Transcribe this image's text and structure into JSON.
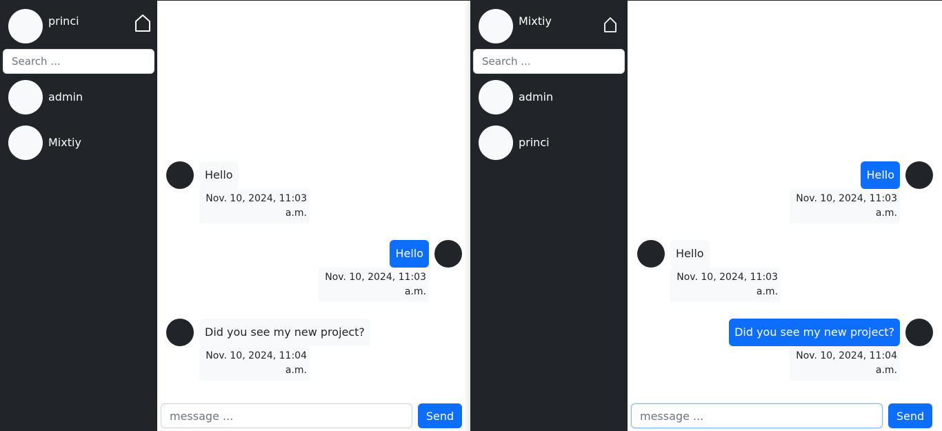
{
  "windows": [
    {
      "current_user": "princi",
      "search_placeholder": "Search ...",
      "contacts": [
        {
          "name": "admin"
        },
        {
          "name": "Mixtiy"
        }
      ],
      "messages": [
        {
          "direction": "in",
          "text": "Hello",
          "timestamp": "Nov. 10, 2024, 11:03 a.m."
        },
        {
          "direction": "out",
          "text": "Hello",
          "timestamp": "Nov. 10, 2024, 11:03 a.m."
        },
        {
          "direction": "in",
          "text": "Did you see my new project?",
          "timestamp": "Nov. 10, 2024, 11:04 a.m."
        }
      ],
      "composer": {
        "placeholder": "message ...",
        "send_label": "Send"
      }
    },
    {
      "current_user": "Mixtiy",
      "search_placeholder": "Search ...",
      "contacts": [
        {
          "name": "admin"
        },
        {
          "name": "princi"
        }
      ],
      "messages": [
        {
          "direction": "out",
          "text": "Hello",
          "timestamp": "Nov. 10, 2024, 11:03 a.m."
        },
        {
          "direction": "in",
          "text": "Hello",
          "timestamp": "Nov. 10, 2024, 11:03 a.m."
        },
        {
          "direction": "out",
          "text": "Did you see my new project?",
          "timestamp": "Nov. 10, 2024, 11:04 a.m."
        }
      ],
      "composer": {
        "placeholder": "message ...",
        "send_label": "Send"
      }
    }
  ],
  "icons": {
    "home": "home-icon"
  },
  "colors": {
    "sidebar_bg": "#212529",
    "accent": "#0d6efd",
    "received_bubble": "#f8f9fa",
    "avatar_light": "#f8f9fa",
    "avatar_dark": "#212529"
  }
}
